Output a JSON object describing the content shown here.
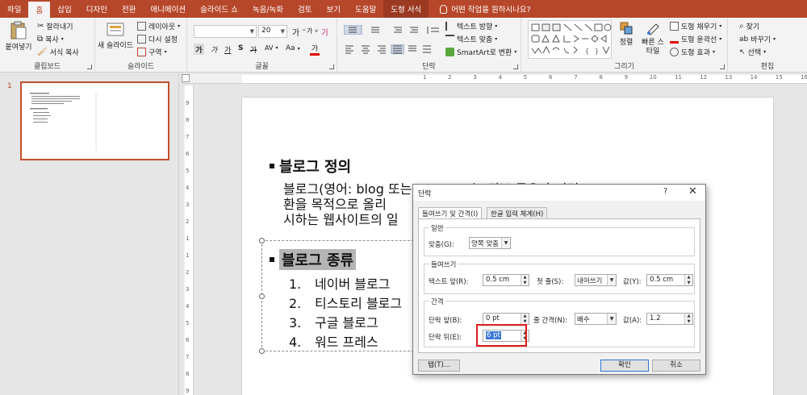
{
  "tabs": [
    "파일",
    "홈",
    "삽입",
    "디자인",
    "전환",
    "애니메이션",
    "슬라이드 쇼",
    "녹음/녹화",
    "검토",
    "보기",
    "도움말",
    "도형 서식"
  ],
  "active_tab": "홈",
  "tell_me": "어떤 작업을 원하시나요?",
  "ribbon": {
    "clipboard": {
      "label": "클립보드",
      "paste": "붙여넣기",
      "cut": "잘라내기",
      "copy": "복사",
      "format_painter": "서식 복사"
    },
    "slides": {
      "label": "슬라이드",
      "new_slide": "새 슬라이드",
      "layout": "레이아웃",
      "reset": "다시 설정",
      "section": "구역"
    },
    "font": {
      "label": "글꼴",
      "font_name": "",
      "font_size": "20",
      "bold": "가",
      "italic": "가",
      "underline": "가",
      "strike": "가",
      "shadow": "S",
      "spacing": "AV",
      "case": "Aa",
      "color": "가",
      "grow": "가",
      "shrink": "가",
      "clear": "가"
    },
    "paragraph": {
      "label": "단락",
      "text_direction": "텍스트 방향",
      "align_text": "텍스트 맞춤",
      "smartart": "SmartArt로 변환"
    },
    "drawing": {
      "label": "그리기",
      "arrange": "정렬",
      "quick_styles": "빠른 스타일",
      "fill": "도형 채우기",
      "outline": "도형 윤곽선",
      "effects": "도형 효과"
    },
    "editing": {
      "label": "편집",
      "find": "찾기",
      "replace": "바꾸기",
      "select": "선택"
    }
  },
  "thumbnail": {
    "number": "1"
  },
  "ruler": {
    "h_ticks": [
      "1",
      "2",
      "3",
      "4",
      "5",
      "6",
      "7",
      "8",
      "9",
      "10",
      "11",
      "12",
      "13",
      "14",
      "15",
      "16",
      "17",
      "18",
      "19",
      "20",
      "21",
      "22"
    ],
    "v_ticks": [
      "9",
      "8",
      "7",
      "6",
      "5",
      "4",
      "3",
      "2",
      "1",
      "1",
      "2",
      "3",
      "4",
      "5",
      "6",
      "7",
      "8",
      "9"
    ]
  },
  "slide": {
    "heading1": "블로그 정의",
    "para_lines": [
      "블로그(영어: blog 또는 web log)는 정보 공유나 의견 교",
      "환을 목적으로 올리",
      "시하는 웹사이트의 일"
    ],
    "heading2": "블로그 종류",
    "list": [
      {
        "num": "1.",
        "text": "네이버 블로그"
      },
      {
        "num": "2.",
        "text": "티스토리 블로그"
      },
      {
        "num": "3.",
        "text": "구글 블로그"
      },
      {
        "num": "4.",
        "text": "워드 프레스"
      }
    ]
  },
  "dialog": {
    "title": "단락",
    "help": "?",
    "close": "✕",
    "tab_active": "들여쓰기 및 간격(I)",
    "tab_inactive": "한글 입력 체계(H)",
    "general": {
      "legend": "일반",
      "align_label": "맞춤(G):",
      "align_value": "양쪽 맞춤"
    },
    "indent": {
      "legend": "들여쓰기",
      "before_label": "텍스트 앞(R):",
      "before_value": "0.5 cm",
      "special_label": "첫 줄(S):",
      "special_value": "내어쓰기",
      "by_label": "값(Y):",
      "by_value": "0.5 cm"
    },
    "spacing": {
      "legend": "간격",
      "before_label": "단락 앞(B):",
      "before_value": "0 pt",
      "line_label": "줄 간격(N):",
      "line_value": "배수",
      "at_label": "값(A):",
      "at_value": "1.2",
      "after_label": "단락 뒤(E):",
      "after_value": "6 pt"
    },
    "tabs_button": "탭(T)...",
    "ok": "확인",
    "cancel": "취소"
  },
  "colors": {
    "accent": "#b7472a",
    "highlight_box": "#e01b1b",
    "font_color_bar": "#e00000"
  }
}
